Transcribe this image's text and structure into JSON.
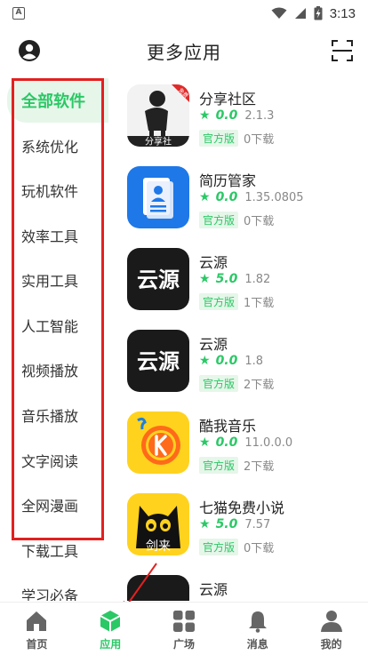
{
  "status_bar": {
    "notification_letter": "A",
    "time": "3:13"
  },
  "header": {
    "title": "更多应用"
  },
  "categories": [
    {
      "label": "全部软件",
      "active": true
    },
    {
      "label": "系统优化"
    },
    {
      "label": "玩机软件"
    },
    {
      "label": "效率工具"
    },
    {
      "label": "实用工具"
    },
    {
      "label": "人工智能"
    },
    {
      "label": "视频播放"
    },
    {
      "label": "音乐播放"
    },
    {
      "label": "文字阅读"
    },
    {
      "label": "全网漫画"
    },
    {
      "label": "下载工具"
    },
    {
      "label": "学习必备"
    }
  ],
  "apps": [
    {
      "name": "分享社区",
      "rating": "0.0",
      "version": "2.1.3",
      "tag": "官方版",
      "downloads": "0下载",
      "icon_text": "分享社",
      "badge": "免费"
    },
    {
      "name": "简历管家",
      "rating": "0.0",
      "version": "1.35.0805",
      "tag": "官方版",
      "downloads": "0下载"
    },
    {
      "name": "云源",
      "rating": "5.0",
      "version": "1.82",
      "tag": "官方版",
      "downloads": "1下载",
      "icon_text": "云源"
    },
    {
      "name": "云源",
      "rating": "0.0",
      "version": "1.8",
      "tag": "官方版",
      "downloads": "2下载",
      "icon_text": "云源"
    },
    {
      "name": "酷我音乐",
      "rating": "0.0",
      "version": "11.0.0.0",
      "tag": "官方版",
      "downloads": "2下载"
    },
    {
      "name": "七猫免费小说",
      "rating": "5.0",
      "version": "7.57",
      "tag": "官方版",
      "downloads": "0下载",
      "icon_text": "剑来"
    },
    {
      "name": "云源"
    }
  ],
  "bottom_nav": [
    {
      "label": "首页",
      "icon": "home-icon"
    },
    {
      "label": "应用",
      "icon": "apps-cube-icon",
      "active": true
    },
    {
      "label": "广场",
      "icon": "grid-icon"
    },
    {
      "label": "消息",
      "icon": "bell-icon"
    },
    {
      "label": "我的",
      "icon": "person-icon"
    }
  ],
  "colors": {
    "accent": "#2bc866",
    "accent_light": "#e6f6e9",
    "annotation_red": "#e32020"
  }
}
